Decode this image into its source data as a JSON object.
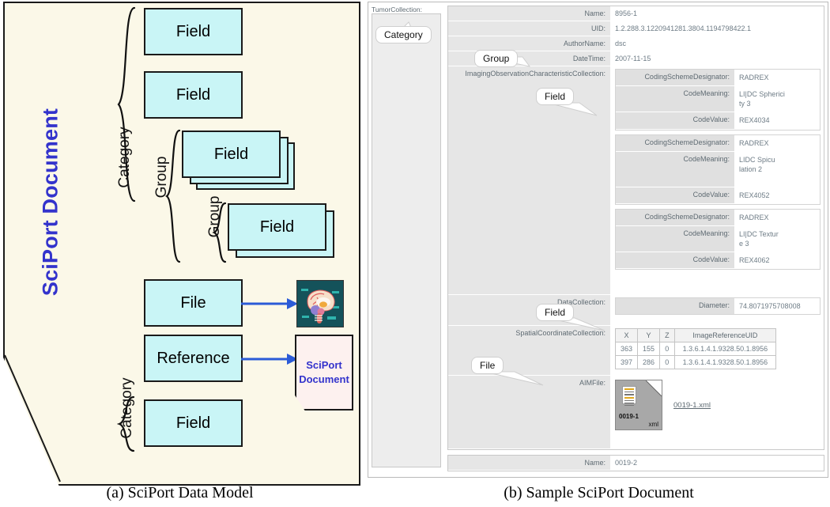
{
  "left": {
    "title": "SciPort Document",
    "caption": "(a) SciPort Data Model",
    "braces": {
      "category_top": "Category",
      "group_outer": "Group",
      "group_inner": "Group",
      "category_bottom": "Category"
    },
    "boxes": {
      "field1": "Field",
      "field2": "Field",
      "field_group_outer": "Field",
      "field_group_inner": "Field",
      "file": "File",
      "reference": "Reference",
      "field_bottom": "Field"
    },
    "targets": {
      "image_icon": "brain-image-icon",
      "note_line1": "SciPort",
      "note_line2": "Document"
    }
  },
  "right": {
    "caption": "(b) Sample SciPort Document",
    "sidebar": {
      "label": "TumorCollection:"
    },
    "callouts": {
      "category": "Category",
      "group": "Group",
      "field_ioc": "Field",
      "field_data": "Field",
      "file": "File"
    },
    "doc1": {
      "rows": [
        {
          "label": "Name:",
          "value": "8956-1"
        },
        {
          "label": "UID:",
          "value": "1.2.288.3.1220941281.3804.1194798422.1"
        },
        {
          "label": "AuthorName:",
          "value": "dsc"
        },
        {
          "label": "DateTime:",
          "value": "2007-11-15"
        }
      ],
      "ioc_label": "ImagingObservationCharacteristicCollection:",
      "ioc_blocks": [
        {
          "designator_label": "CodingSchemeDesignator:",
          "designator": "RADREX",
          "meaning_label": "CodeMeaning:",
          "meaning": "LI|DC Sphericity 3",
          "value_label": "CodeValue:",
          "value": "REX4034"
        },
        {
          "designator_label": "CodingSchemeDesignator:",
          "designator": "RADREX",
          "meaning_label": "CodeMeaning:",
          "meaning": "LIDC Spiculation 2",
          "value_label": "CodeValue:",
          "value": "REX4052"
        },
        {
          "designator_label": "CodingSchemeDesignator:",
          "designator": "RADREX",
          "meaning_label": "CodeMeaning:",
          "meaning": "LI|DC Texture 3",
          "value_label": "CodeValue:",
          "value": "REX4062"
        }
      ],
      "data_label": "DataCollection:",
      "diameter_label": "Diameter:",
      "diameter_value": "74.8071975708008",
      "spatial_label": "SpatialCoordinateCollection:",
      "coord_headers": [
        "X",
        "Y",
        "Z",
        "ImageReferenceUID"
      ],
      "coord_rows": [
        [
          "363",
          "155",
          "0",
          "1.3.6.1.4.1.9328.50.1.8956"
        ],
        [
          "397",
          "286",
          "0",
          "1.3.6.1.4.1.9328.50.1.8956"
        ]
      ],
      "aim_label": "AIMFile:",
      "file_thumb_name": "0019-1",
      "file_thumb_ext": "xml",
      "file_link": "0019-1.xml"
    },
    "doc2": {
      "rows": [
        {
          "label": "Name:",
          "value": "0019-2"
        }
      ]
    }
  },
  "colors": {
    "field_fill": "#c9f5f6",
    "doc_bg": "#fbf8e8",
    "title_blue": "#3333cc",
    "arrow_blue": "#2b5bd7",
    "label_gray": "#e6e6e6",
    "value_text": "#6e7c86"
  }
}
